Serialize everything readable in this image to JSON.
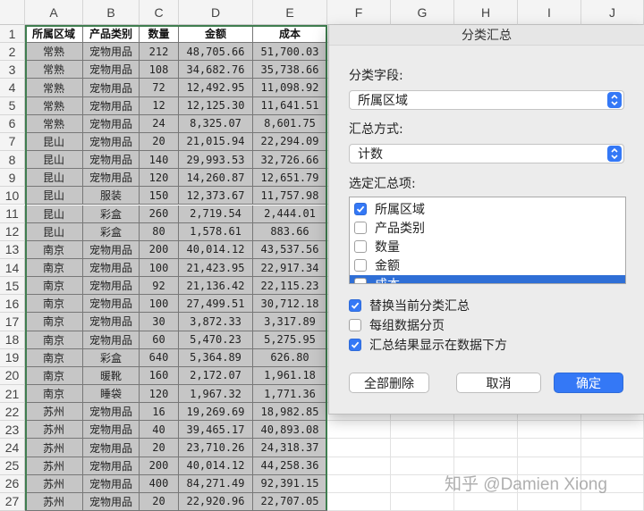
{
  "columns": [
    "A",
    "B",
    "C",
    "D",
    "E",
    "F",
    "G",
    "H",
    "I",
    "J"
  ],
  "row_numbers": [
    "1",
    "2",
    "3",
    "4",
    "5",
    "6",
    "7",
    "8",
    "9",
    "10",
    "11",
    "12",
    "13",
    "14",
    "15",
    "16",
    "17",
    "18",
    "19",
    "20",
    "21",
    "22",
    "23",
    "24",
    "25",
    "26",
    "27"
  ],
  "table": {
    "headers": [
      "所属区域",
      "产品类别",
      "数量",
      "金额",
      "成本"
    ],
    "rows": [
      [
        "常熟",
        "宠物用品",
        "212",
        "48,705.66",
        "51,700.03"
      ],
      [
        "常熟",
        "宠物用品",
        "108",
        "34,682.76",
        "35,738.66"
      ],
      [
        "常熟",
        "宠物用品",
        "72",
        "12,492.95",
        "11,098.92"
      ],
      [
        "常熟",
        "宠物用品",
        "12",
        "12,125.30",
        "11,641.51"
      ],
      [
        "常熟",
        "宠物用品",
        "24",
        "8,325.07",
        "8,601.75"
      ],
      [
        "昆山",
        "宠物用品",
        "20",
        "21,015.94",
        "22,294.09"
      ],
      [
        "昆山",
        "宠物用品",
        "140",
        "29,993.53",
        "32,726.66"
      ],
      [
        "昆山",
        "宠物用品",
        "120",
        "14,260.87",
        "12,651.79"
      ],
      [
        "昆山",
        "服装",
        "150",
        "12,373.67",
        "11,757.98"
      ],
      [
        "昆山",
        "彩盒",
        "260",
        "2,719.54",
        "2,444.01"
      ],
      [
        "昆山",
        "彩盒",
        "80",
        "1,578.61",
        "883.66"
      ],
      [
        "南京",
        "宠物用品",
        "200",
        "40,014.12",
        "43,537.56"
      ],
      [
        "南京",
        "宠物用品",
        "100",
        "21,423.95",
        "22,917.34"
      ],
      [
        "南京",
        "宠物用品",
        "92",
        "21,136.42",
        "22,115.23"
      ],
      [
        "南京",
        "宠物用品",
        "100",
        "27,499.51",
        "30,712.18"
      ],
      [
        "南京",
        "宠物用品",
        "30",
        "3,872.33",
        "3,317.89"
      ],
      [
        "南京",
        "宠物用品",
        "60",
        "5,470.23",
        "5,275.95"
      ],
      [
        "南京",
        "彩盒",
        "640",
        "5,364.89",
        "626.80"
      ],
      [
        "南京",
        "暖靴",
        "160",
        "2,172.07",
        "1,961.18"
      ],
      [
        "南京",
        "睡袋",
        "120",
        "1,967.32",
        "1,771.36"
      ],
      [
        "苏州",
        "宠物用品",
        "16",
        "19,269.69",
        "18,982.85"
      ],
      [
        "苏州",
        "宠物用品",
        "40",
        "39,465.17",
        "40,893.08"
      ],
      [
        "苏州",
        "宠物用品",
        "20",
        "23,710.26",
        "24,318.37"
      ],
      [
        "苏州",
        "宠物用品",
        "200",
        "40,014.12",
        "44,258.36"
      ],
      [
        "苏州",
        "宠物用品",
        "400",
        "84,271.49",
        "92,391.15"
      ],
      [
        "苏州",
        "宠物用品",
        "20",
        "22,920.96",
        "22,707.05"
      ]
    ]
  },
  "dialog": {
    "title": "分类汇总",
    "group_field_label": "分类字段:",
    "group_field_value": "所属区域",
    "function_label": "汇总方式:",
    "function_value": "计数",
    "items_label": "选定汇总项:",
    "items": [
      {
        "label": "所属区域",
        "checked": true
      },
      {
        "label": "产品类别",
        "checked": false
      },
      {
        "label": "数量",
        "checked": false
      },
      {
        "label": "金额",
        "checked": false
      },
      {
        "label": "成本",
        "checked": false
      }
    ],
    "options": [
      {
        "label": "替换当前分类汇总",
        "checked": true
      },
      {
        "label": "每组数据分页",
        "checked": false
      },
      {
        "label": "汇总结果显示在数据下方",
        "checked": true
      }
    ],
    "buttons": {
      "remove_all": "全部删除",
      "cancel": "取消",
      "ok": "确定"
    },
    "accent_color": "#3478f6"
  },
  "watermark": "知乎 @Damien Xiong"
}
